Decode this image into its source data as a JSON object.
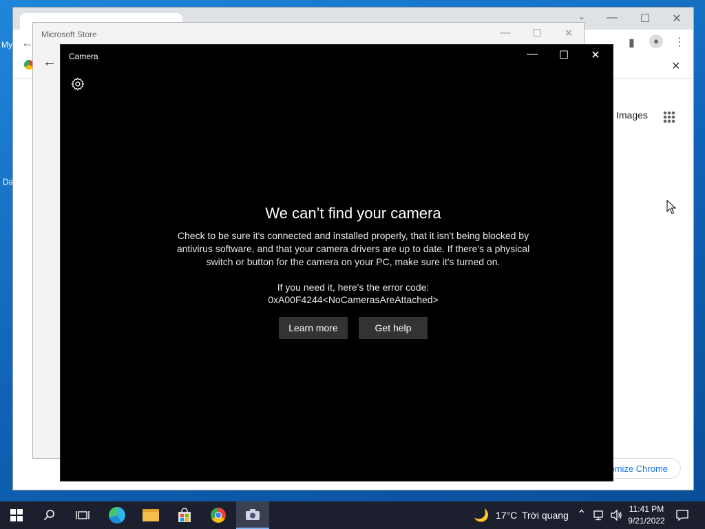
{
  "desktop": {
    "icon_labels": [
      "My",
      "Da"
    ]
  },
  "chrome": {
    "links": {
      "images": "Images"
    },
    "customize_label": "tomize Chrome",
    "controls": {
      "minimize": "—",
      "maximize": "☐",
      "close": "✕"
    }
  },
  "store": {
    "title": "Microsoft Store"
  },
  "camera": {
    "title": "Camera",
    "heading": "We can’t find your camera",
    "body": "Check to be sure it's connected and installed properly, that it isn't being blocked by antivirus software, and that your camera drivers are up to date. If there's a physical switch or button for the camera on your PC, make sure it's turned on.",
    "error_intro": "If you need it, here's the error code:",
    "error_code": "0xA00F4244<NoCamerasAreAttached>",
    "learn_more": "Learn more",
    "get_help": "Get help"
  },
  "taskbar": {
    "weather_temp": "17°C",
    "weather_desc": "Trời quang",
    "time": "11:41 PM",
    "date": "9/21/2022"
  },
  "colors": {
    "accent": "#1a73e8",
    "camera_bg": "#000000",
    "button_bg": "#333333",
    "taskbar_bg": "#1b1f2e"
  }
}
